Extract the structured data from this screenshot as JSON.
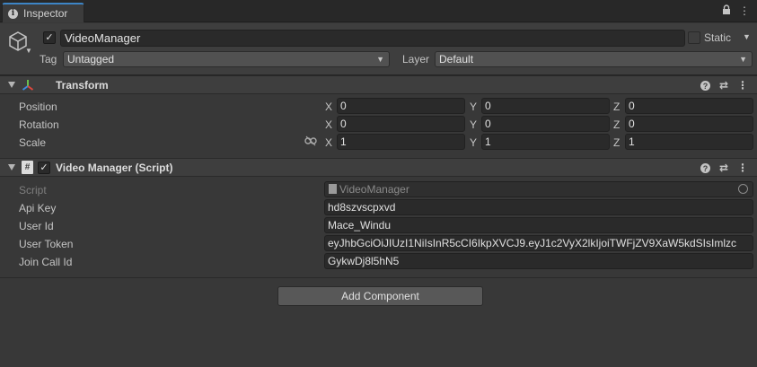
{
  "tab": {
    "title": "Inspector"
  },
  "header": {
    "object_name": "VideoManager",
    "active_check": "✓",
    "static_label": "Static",
    "tag_label": "Tag",
    "tag_value": "Untagged",
    "layer_label": "Layer",
    "layer_value": "Default"
  },
  "transform": {
    "title": "Transform",
    "rows": [
      {
        "label": "Position",
        "x": "0",
        "y": "0",
        "z": "0"
      },
      {
        "label": "Rotation",
        "x": "0",
        "y": "0",
        "z": "0"
      },
      {
        "label": "Scale",
        "x": "1",
        "y": "1",
        "z": "1"
      }
    ],
    "axis_x": "X",
    "axis_y": "Y",
    "axis_z": "Z"
  },
  "script_component": {
    "title": "Video Manager (Script)",
    "enabled_check": "✓",
    "script_label": "Script",
    "script_value": "VideoManager",
    "fields": [
      {
        "label": "Api Key",
        "value": "hd8szvscpxvd"
      },
      {
        "label": "User Id",
        "value": "Mace_Windu"
      },
      {
        "label": "User Token",
        "value": "eyJhbGciOiJIUzI1NiIsInR5cCI6IkpXVCJ9.eyJ1c2VyX2lkIjoiTWFjZV9XaW5kdSIsImlzc"
      },
      {
        "label": "Join Call Id",
        "value": "GykwDj8l5hN5"
      }
    ]
  },
  "add_component": {
    "label": "Add Component"
  },
  "icons": {
    "tab": "info-icon",
    "lock": "lock-icon",
    "menu": "kebab-menu-icon",
    "gameobject": "cube-icon",
    "transform": "transform-axes-icon",
    "script": "csharp-script-icon",
    "help": "help-icon",
    "presets": "presets-icon",
    "link": "link-icon"
  }
}
